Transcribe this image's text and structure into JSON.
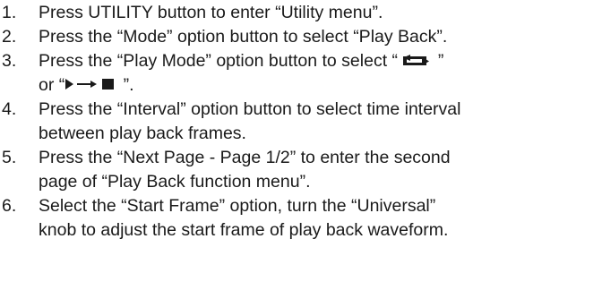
{
  "steps": [
    {
      "num": "1.",
      "lines": [
        "Press UTILITY button to enter “Utility menu”."
      ]
    },
    {
      "num": "2.",
      "lines": [
        "Press the “Mode” option button to select “Play Back”."
      ]
    },
    {
      "num": "3.",
      "pre": "Press the “Play Mode” option button to select “ ",
      "mid": " ”",
      "or_open": "or “",
      "post": " ”.",
      "icon_loop": "loop-arrows-icon",
      "icon_play_stop": "play-to-stop-icon"
    },
    {
      "num": "4.",
      "lines": [
        "Press the “Interval” option button to select time interval",
        "between play back frames."
      ]
    },
    {
      "num": "5.",
      "lines": [
        "Press the “Next Page - Page 1/2” to enter the second",
        "page of “Play Back function menu”."
      ]
    },
    {
      "num": "6.",
      "lines": [
        "Select the “Start Frame” option, turn the “Universal”",
        "knob to adjust the start frame of play back waveform."
      ]
    }
  ],
  "colors": {
    "text": "#1a1a1a",
    "background": "#ffffff"
  }
}
